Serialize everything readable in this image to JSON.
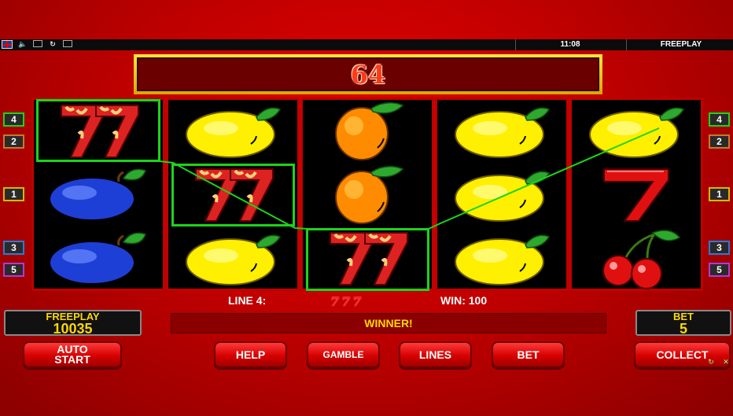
{
  "top_bar": {
    "icons": [
      "flag-uk-icon",
      "speaker-icon",
      "screen-icon",
      "refresh-icon",
      "window-icon"
    ],
    "time": "11:08",
    "mode": "FREEPLAY"
  },
  "win_display": {
    "value": "64"
  },
  "line_indicators": {
    "left": [
      "4",
      "2",
      "1",
      "3",
      "5"
    ],
    "right": [
      "4",
      "2",
      "1",
      "3",
      "5"
    ]
  },
  "reels": [
    [
      "seven",
      "plum",
      "plum"
    ],
    [
      "lemon",
      "seven",
      "lemon"
    ],
    [
      "orange",
      "orange",
      "seven"
    ],
    [
      "lemon",
      "lemon",
      "lemon"
    ],
    [
      "lemon",
      "red-seven",
      "cherry"
    ]
  ],
  "win_info": {
    "line_label": "LINE 4:",
    "symbols": "777",
    "win_label": "WIN: 100"
  },
  "freeplay_panel": {
    "label": "FREEPLAY",
    "value": "10035"
  },
  "message": "WINNER!",
  "bet_panel": {
    "label": "BET",
    "value": "5"
  },
  "buttons": {
    "auto_start": "AUTO\nSTART",
    "help": "HELP",
    "gamble": "GAMBLE",
    "lines": "LINES",
    "bet": "BET",
    "collect": "COLLECT"
  },
  "colors": {
    "background": "#c20000",
    "win_frame": "#1ad51a",
    "gold": "#ffd700"
  }
}
